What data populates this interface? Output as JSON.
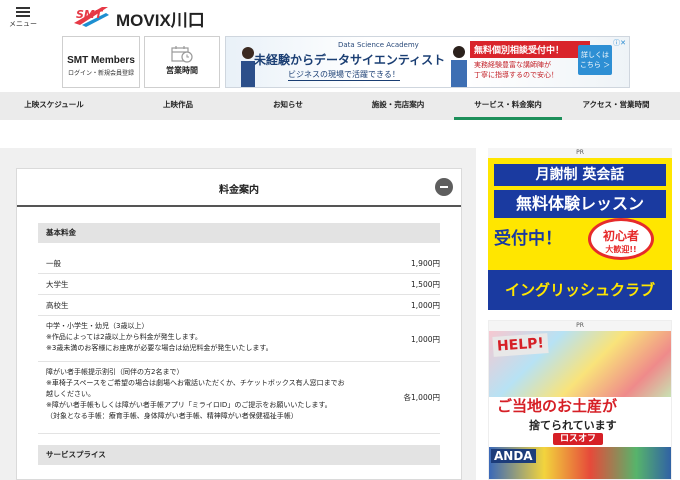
{
  "header": {
    "menu_label": "メニュー",
    "logo_text": "SMT",
    "site_title": "MOVIX川口",
    "members": {
      "title": "SMT Members",
      "subtitle": "ログイン・新規会員登録"
    },
    "hours": {
      "label": "営業時間"
    }
  },
  "top_ad": {
    "brand": "Data Science Academy",
    "headline": "未経験からデータサイエンティスト",
    "sub": "ビジネスの現場で活躍できる！",
    "red_banner": "無料個別相談受付中！",
    "red_line1": "実務経験豊富な講師陣が",
    "red_line2": "丁寧に指導するので安心！",
    "cta": "詳しくは こちら ＞"
  },
  "nav": {
    "items": [
      {
        "label": "上映スケジュール"
      },
      {
        "label": "上映作品"
      },
      {
        "label": "お知らせ"
      },
      {
        "label": "施設・売店案内"
      },
      {
        "label": "サービス・料金案内"
      },
      {
        "label": "アクセス・営業時間"
      }
    ],
    "active_index": 4,
    "active_color": "#1d8f5a"
  },
  "price_section": {
    "title": "料金案内",
    "basic_header": "基本料金",
    "rows": [
      {
        "label": "一般",
        "value": "1,900円"
      },
      {
        "label": "大学生",
        "value": "1,500円"
      },
      {
        "label": "高校生",
        "value": "1,000円"
      },
      {
        "label": "中学・小学生・幼児（3歳以上）",
        "value": "1,000円",
        "notes": [
          "※作品によっては2歳以上から料金が発生します。",
          "※3歳未満のお客様にお座席が必要な場合は幼児料金が発生いたします。"
        ]
      },
      {
        "label": "障がい者手帳提示割引（同伴の方2名まで）",
        "value": "各1,000円",
        "notes": [
          "※車椅子スペースをご希望の場合は劇場へお電話いただくか、チケットボックス有人窓口までお",
          "越しください。",
          "※障がい者手帳もしくは障がい者手帳アプリ「ミライロID」のご提示をお願いいたします。",
          "（対象となる手帳：療育手帳、身体障がい者手帳、精神障がい者保健福祉手帳）"
        ]
      }
    ],
    "service_header": "サービスプライス"
  },
  "side_ads": {
    "pr_label": "PR",
    "ad1": {
      "line1": "月謝制 英会話",
      "line2": "無料体験レッスン",
      "line3": "受付中！",
      "badge1": "初心者",
      "badge2": "大歓迎!!",
      "bottom": "イングリッシュクラブ"
    },
    "ad2": {
      "help": "HELP!",
      "text1": "ご当地のお土産が",
      "text2": "捨てられています",
      "logo": "ロスオフ",
      "bottom_word": "ANDA"
    }
  }
}
